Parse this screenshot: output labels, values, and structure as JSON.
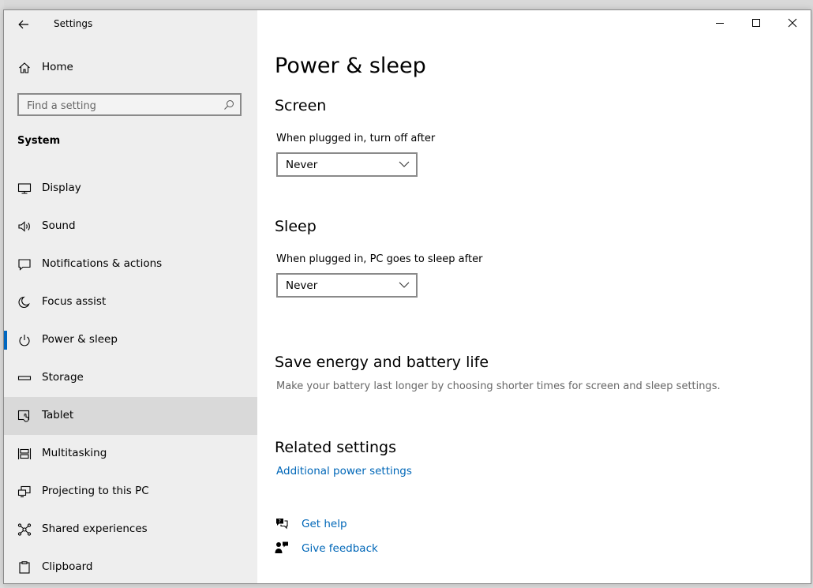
{
  "window": {
    "title": "Settings"
  },
  "sidebar": {
    "home_label": "Home",
    "search_placeholder": "Find a setting",
    "section": "System",
    "items": [
      {
        "label": "Display",
        "icon": "monitor-icon"
      },
      {
        "label": "Sound",
        "icon": "speaker-icon"
      },
      {
        "label": "Notifications & actions",
        "icon": "notification-icon"
      },
      {
        "label": "Focus assist",
        "icon": "moon-icon"
      },
      {
        "label": "Power & sleep",
        "icon": "power-icon",
        "selected": true
      },
      {
        "label": "Storage",
        "icon": "storage-icon"
      },
      {
        "label": "Tablet",
        "icon": "tablet-icon",
        "hovered": true
      },
      {
        "label": "Multitasking",
        "icon": "multitasking-icon"
      },
      {
        "label": "Projecting to this PC",
        "icon": "projecting-icon"
      },
      {
        "label": "Shared experiences",
        "icon": "share-icon"
      },
      {
        "label": "Clipboard",
        "icon": "clipboard-icon"
      }
    ]
  },
  "main": {
    "title": "Power & sleep",
    "screen": {
      "heading": "Screen",
      "label": "When plugged in, turn off after",
      "value": "Never"
    },
    "sleep": {
      "heading": "Sleep",
      "label": "When plugged in, PC goes to sleep after",
      "value": "Never"
    },
    "energy": {
      "heading": "Save energy and battery life",
      "description": "Make your battery last longer by choosing shorter times for screen and sleep settings."
    },
    "related": {
      "heading": "Related settings",
      "link": "Additional power settings"
    },
    "help": {
      "get_help": "Get help",
      "give_feedback": "Give feedback"
    }
  },
  "colors": {
    "accent": "#0067c0",
    "link": "#0067b8",
    "sidebar_bg": "#eeeeee",
    "hover_bg": "#d9d9d9"
  }
}
